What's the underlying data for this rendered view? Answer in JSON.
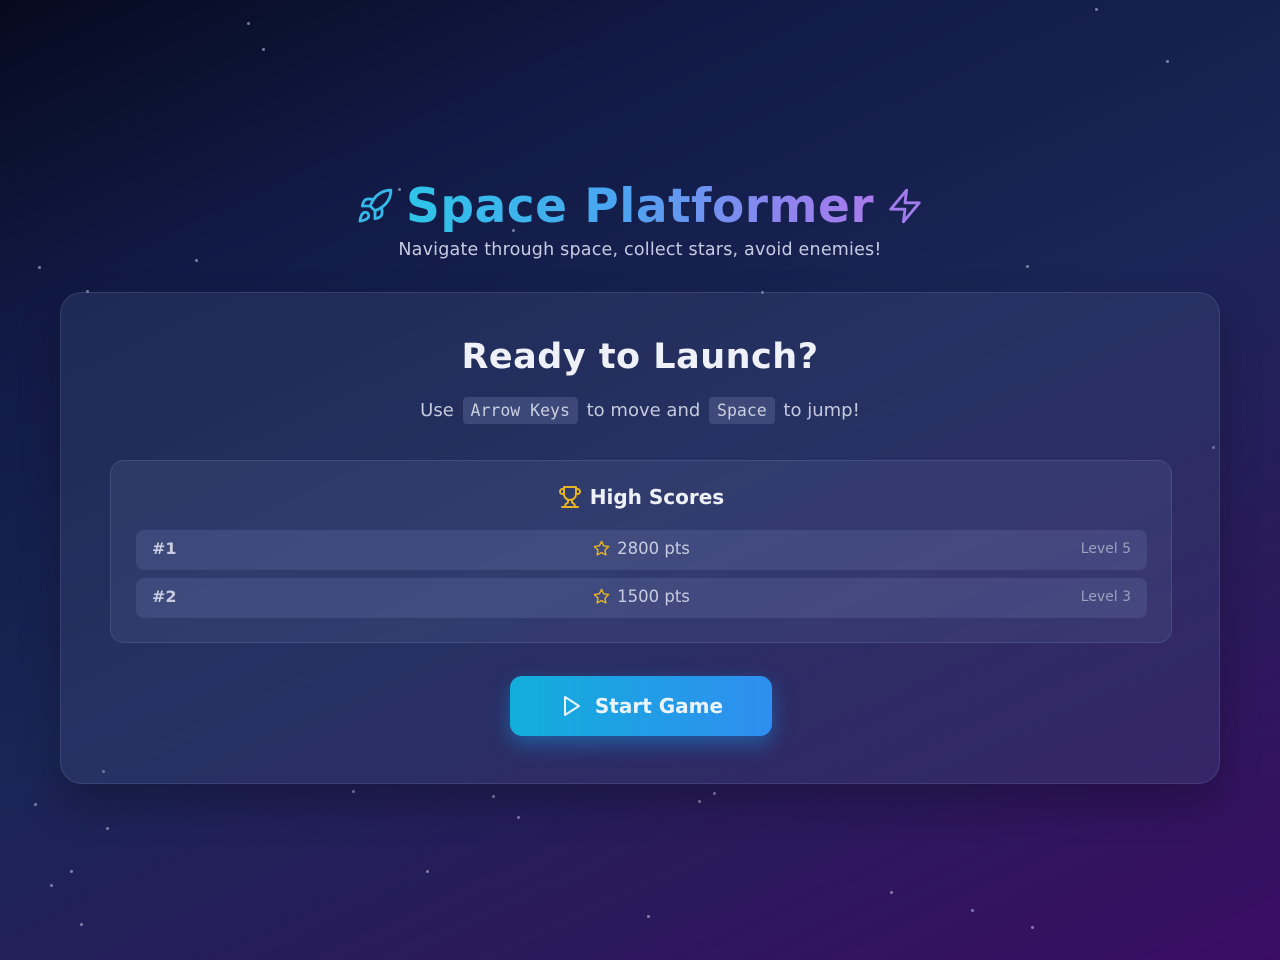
{
  "header": {
    "title": "Space Platformer",
    "subtitle": "Navigate through space, collect stars, avoid enemies!",
    "left_icon": "rocket-icon",
    "right_icon": "lightning-icon"
  },
  "card": {
    "title": "Ready to Launch?",
    "instructions": {
      "prefix": "Use",
      "key1": "Arrow Keys",
      "middle": "to move and",
      "key2": "Space",
      "suffix": "to jump!"
    }
  },
  "high_scores": {
    "heading": "High Scores",
    "heading_icon": "trophy-icon",
    "entries": [
      {
        "rank": "#1",
        "points": "2800 pts",
        "level": "Level 5"
      },
      {
        "rank": "#2",
        "points": "1500 pts",
        "level": "Level 3"
      }
    ]
  },
  "start_button": {
    "label": "Start Game",
    "icon": "play-icon"
  },
  "colors": {
    "accent_cyan": "#2ec5e8",
    "accent_purple": "#a97aec",
    "trophy_gold": "#e6b422",
    "button_start": "#12aedb",
    "button_end": "#2f8ef0"
  }
}
